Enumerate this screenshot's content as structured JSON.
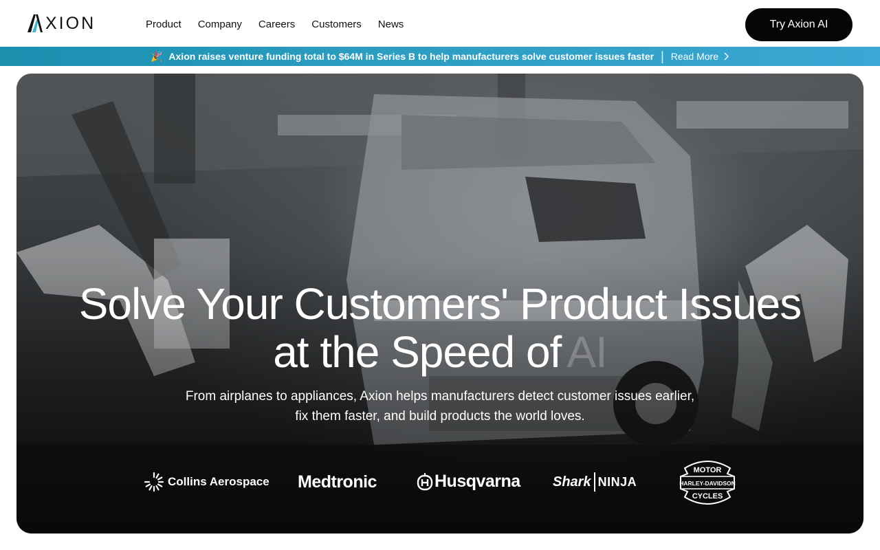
{
  "header": {
    "logo_text": "XION",
    "nav": [
      "Product",
      "Company",
      "Careers",
      "Customers",
      "News"
    ],
    "cta_label": "Try Axion AI"
  },
  "announcement": {
    "emoji": "🎉",
    "message": "Axion raises venture funding total to $64M in Series B to help manufacturers solve customer issues faster",
    "separator": "|",
    "link_label": "Read More"
  },
  "hero": {
    "headline_line1": "Solve Your Customers' Product Issues",
    "headline_line2": "at the Speed of",
    "headline_ai": "AI",
    "subheadline": "From airplanes to appliances, Axion helps manufacturers detect customer issues earlier, fix them faster, and build products the world loves."
  },
  "customer_logos": {
    "collins": "Collins Aerospace",
    "medtronic": "Medtronic",
    "husqvarna": "Husqvarna",
    "shark": "Shark",
    "ninja": "NINJA",
    "harley_top": "MOTOR",
    "harley_mid": "HARLEY-DAVIDSON",
    "harley_bottom": "CYCLES"
  },
  "colors": {
    "announcement_bar": "#2a9dc0",
    "logo_accent": "#3fb6d4",
    "cta_bg": "#050505"
  }
}
